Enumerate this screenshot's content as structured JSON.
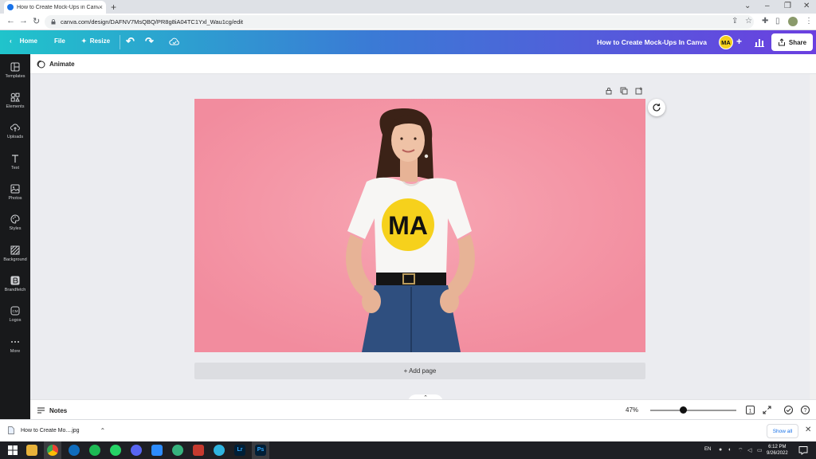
{
  "browser": {
    "tab_title": "How to Create Mock-Ups in Canv",
    "url": "canva.com/design/DAFNV7MsQBQ/PR8g8iA04TC1Yxl_Wau1cg/edit"
  },
  "header": {
    "home_label": "Home",
    "file_label": "File",
    "resize_label": "Resize",
    "design_title": "How to Create Mock-Ups In Canva",
    "avatar_initials": "MA",
    "share_label": "Share"
  },
  "sidebar": {
    "items": [
      {
        "label": "Templates",
        "icon": "templates-icon"
      },
      {
        "label": "Elements",
        "icon": "elements-icon"
      },
      {
        "label": "Uploads",
        "icon": "uploads-icon"
      },
      {
        "label": "Text",
        "icon": "text-icon"
      },
      {
        "label": "Photos",
        "icon": "photos-icon"
      },
      {
        "label": "Styles",
        "icon": "styles-icon"
      },
      {
        "label": "Background",
        "icon": "background-icon"
      },
      {
        "label": "Brandfetch",
        "icon": "brandfetch-icon"
      },
      {
        "label": "Logos",
        "icon": "logos-icon"
      },
      {
        "label": "More",
        "icon": "more-icon"
      }
    ]
  },
  "toolbar": {
    "animate_label": "Animate"
  },
  "canvas": {
    "background_color": "#f392a3",
    "shirt_logo_text": "MA",
    "add_page_label": "+ Add page"
  },
  "footer": {
    "notes_label": "Notes",
    "zoom_level": "47%",
    "page_count": "1"
  },
  "downloads": {
    "file_name": "How to Create Mo....jpg",
    "show_all_label": "Show all"
  },
  "taskbar": {
    "language": "EN",
    "time": "6:12 PM",
    "date": "9/26/2022",
    "photoshop_label": "Ps",
    "lightroom_label": "Lr"
  },
  "colors": {
    "header_gradient_start": "#20c4cb",
    "header_gradient_end": "#6b3fe0",
    "avatar_yellow": "#f6d11c",
    "sidebar_bg": "#18191b"
  }
}
